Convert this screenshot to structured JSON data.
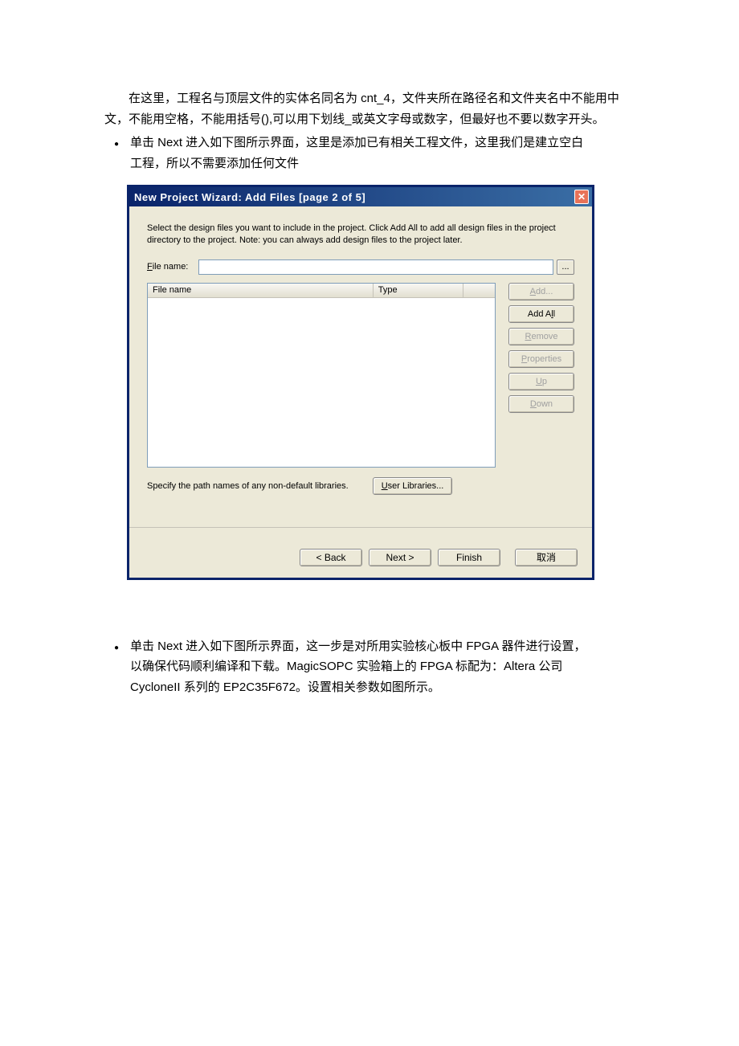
{
  "document": {
    "paragraph1": "在这里，工程名与顶层文件的实体名同名为 cnt_4，文件夹所在路径名和文件夹名中不能用中文，不能用空格，不能用括号(),可以用下划线_或英文字母或数字，但最好也不要以数字开头。",
    "bullet1_line1": "单击 Next 进入如下图所示界面，这里是添加已有相关工程文件，这里我们是建立空白",
    "bullet1_line2": "工程，所以不需要添加任何文件",
    "bullet2_line1": "单击 Next 进入如下图所示界面，这一步是对所用实验核心板中 FPGA 器件进行设置，",
    "bullet2_line2": "以确保代码顺利编译和下载。MagicSOPC 实验箱上的 FPGA 标配为：Altera 公司",
    "bullet2_line3": "CycloneII 系列的 EP2C35F672。设置相关参数如图所示。"
  },
  "dialog": {
    "title": "New Project Wizard: Add Files [page 2 of 5]",
    "instructions": "Select the design files you want to include in the project. Click Add All to add all design files in the project directory to the project. Note: you can always add design files to the project later.",
    "filename_label_pre": "F",
    "filename_label_post": "ile name:",
    "browse_btn": "...",
    "table": {
      "col_filename": "File name",
      "col_type": "Type"
    },
    "buttons": {
      "add_pre": "A",
      "add_post": "dd...",
      "addall_pre": "Add A",
      "addall_mn": "l",
      "addall_post": "l",
      "remove_pre": "R",
      "remove_post": "emove",
      "properties_pre": "P",
      "properties_post": "roperties",
      "up_pre": "U",
      "up_post": "p",
      "down_pre": "D",
      "down_post": "own"
    },
    "libraries_text": "Specify the path names of any non-default libraries.",
    "user_libraries_pre": "U",
    "user_libraries_post": "ser Libraries...",
    "nav": {
      "back": "< Back",
      "next": "Next >",
      "finish": "Finish",
      "cancel": "取消"
    }
  }
}
